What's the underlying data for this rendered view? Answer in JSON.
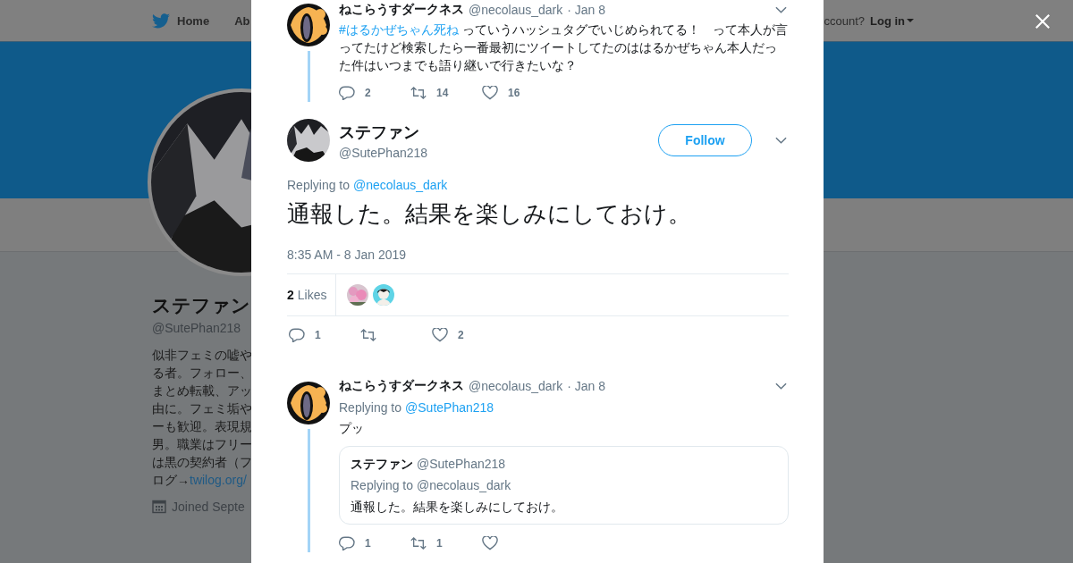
{
  "background_page": {
    "nav": {
      "items": [
        "Home",
        "Ab"
      ],
      "login_prompt": "ccount?",
      "login": "Log in"
    },
    "profile": {
      "name": "ステファン",
      "handle": "@SutePhan218",
      "bio_lines": [
        "似非フェミの嘘や",
        "る者。フォロー、",
        "まとめ転載、アッ",
        "由に。フェミ垢や",
        "ーも歓迎。表現規",
        "男。職業はフリー",
        "は黒の契約者（フ",
        "ログ→"
      ],
      "bio_link": "twilog.org/",
      "joined": "Joined Septe"
    }
  },
  "modal": {
    "parent_tweet": {
      "name": "ねこらうすダークネス",
      "handle": "@necolaus_dark",
      "date": "· Jan 8",
      "hashtag": "#はるかぜちゃん死ね",
      "text": " っていうハッシュタグでいじめられてる！　って本人が言ってたけど検索したら一番最初にツイートしてたのははるかぜちゃん本人だった件はいつまでも語り継いで行きたいな？",
      "actions": [
        {
          "kind": "reply",
          "count": "2"
        },
        {
          "kind": "retweet",
          "count": "14"
        },
        {
          "kind": "like",
          "count": "16"
        }
      ]
    },
    "main_tweet": {
      "name": "ステファン",
      "handle": "@SutePhan218",
      "follow": "Follow",
      "replying_label": "Replying to",
      "replying_to": "@necolaus_dark",
      "text": "通報した。結果を楽しみにしておけ。",
      "time": "8:35 AM - 8 Jan 2019",
      "likes_count": "2",
      "likes_label": "Likes",
      "actions": [
        {
          "kind": "reply",
          "count": "1"
        },
        {
          "kind": "retweet"
        },
        {
          "kind": "like",
          "count": "2"
        }
      ]
    },
    "reply": {
      "name": "ねこらうすダークネス",
      "handle": "@necolaus_dark",
      "date": "· Jan 8",
      "replying_label": "Replying to",
      "replying_to": "@SutePhan218",
      "text": "プッ",
      "quote": {
        "name": "ステファン",
        "handle": "@SutePhan218",
        "replying": "Replying to @necolaus_dark",
        "text": "通報した。結果を楽しみにしておけ。"
      },
      "actions": [
        {
          "kind": "reply",
          "count": "1"
        },
        {
          "kind": "retweet",
          "count": "1"
        },
        {
          "kind": "like"
        }
      ]
    }
  }
}
